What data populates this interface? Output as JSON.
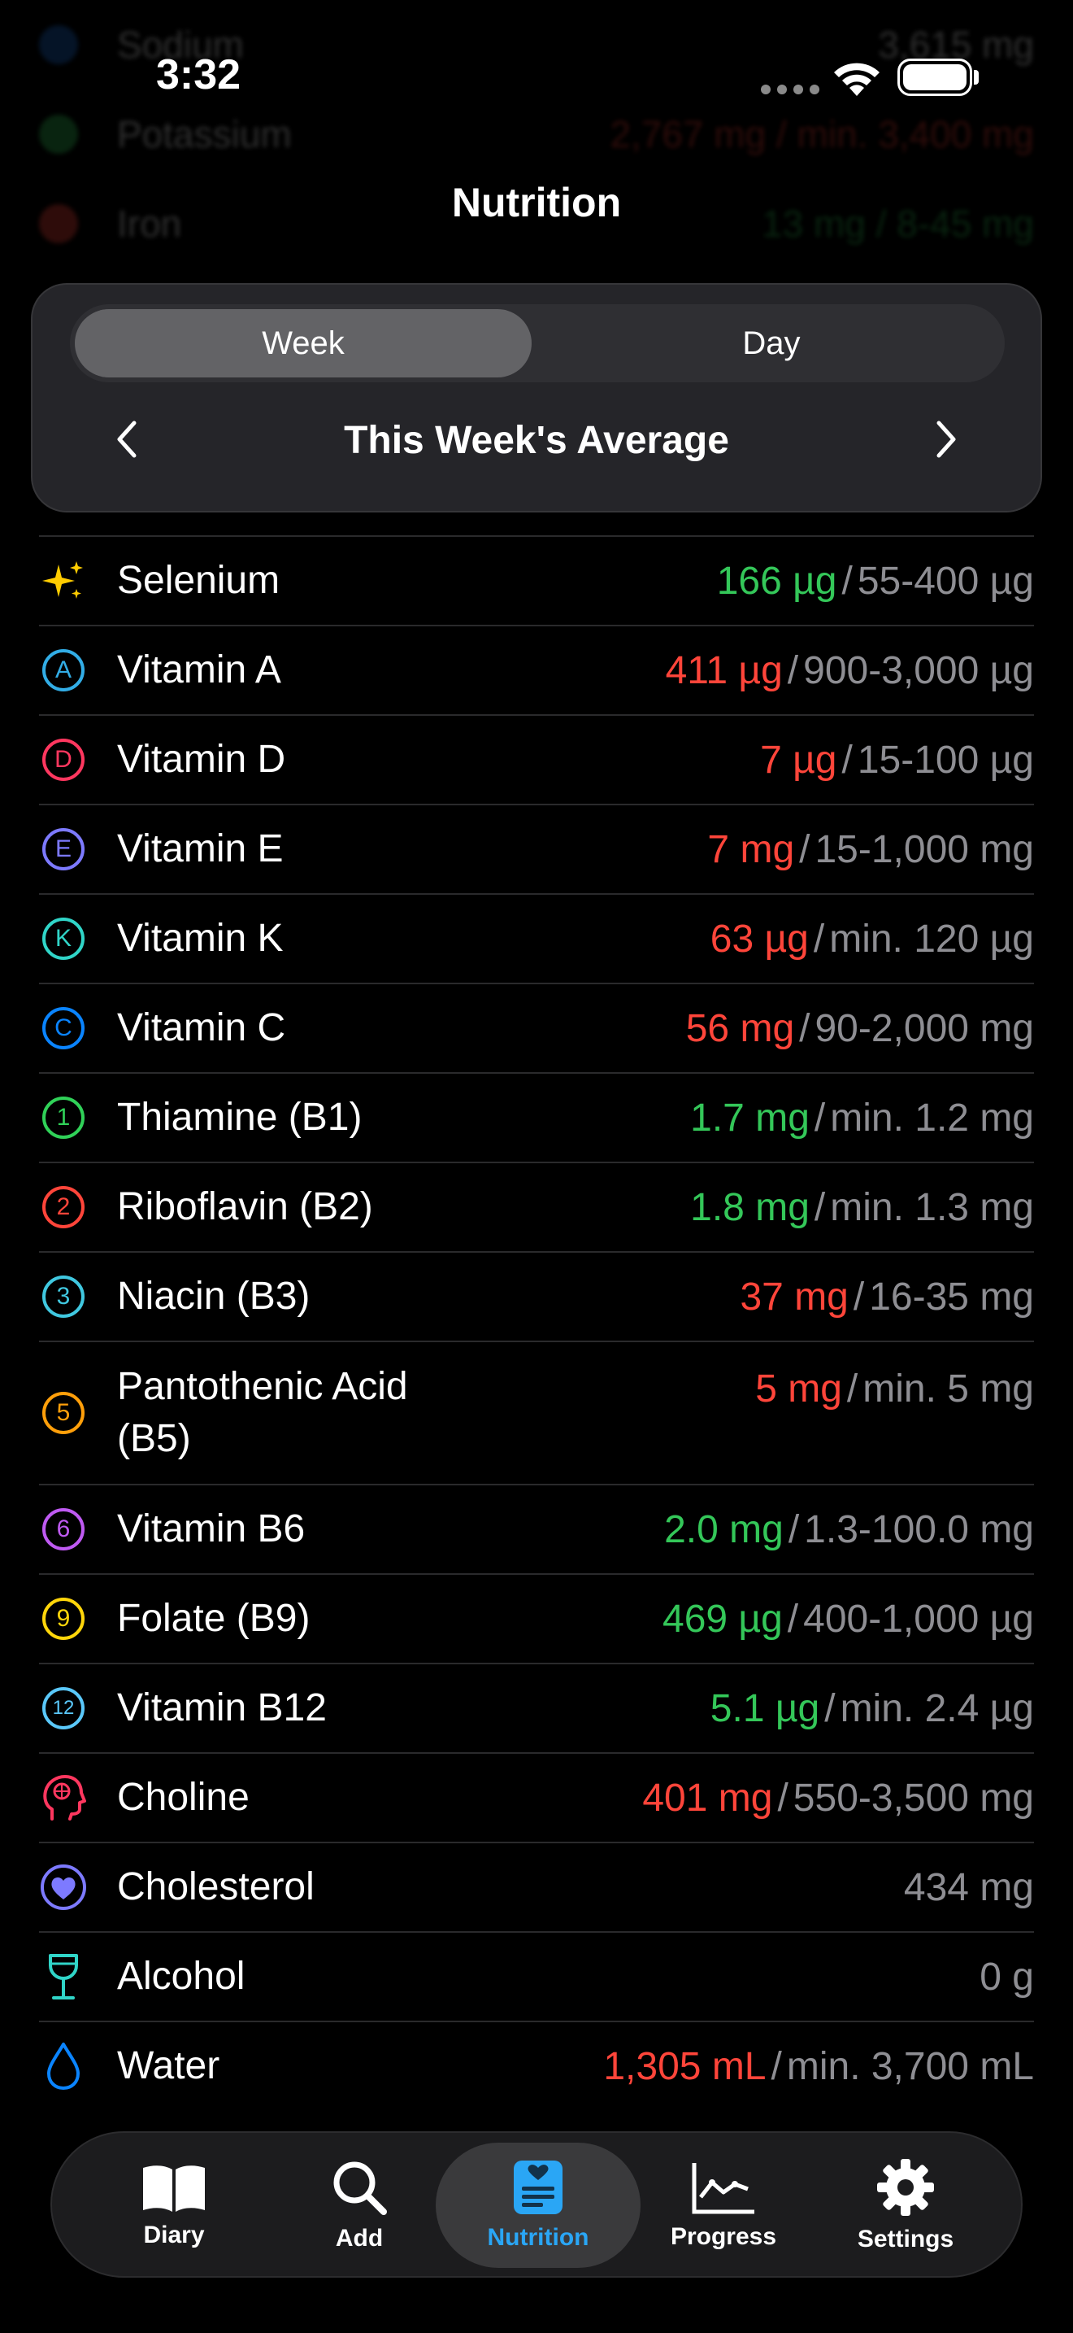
{
  "status": {
    "time": "3:32"
  },
  "header": {
    "title": "Nutrition"
  },
  "background_rows": [
    {
      "name": "Sodium",
      "value": "3,615 mg"
    },
    {
      "name": "Potassium",
      "value": "2,767 mg / min. 3,400 mg"
    },
    {
      "name": "Iron",
      "value": "13 mg / 8-45 mg"
    }
  ],
  "filter": {
    "segments": [
      "Week",
      "Day"
    ],
    "selected": "Week",
    "period_title": "This Week's Average"
  },
  "colors": {
    "green": "#34c759",
    "red": "#ff453a",
    "gray": "#8e8e93",
    "accent": "#2aa6f5"
  },
  "nutrients": [
    {
      "icon": "sparkles-icon",
      "name": "Selenium",
      "amount": "166 µg",
      "status": "green",
      "range": "55-400 µg"
    },
    {
      "icon": "vitamin-a-icon",
      "glyph": "A",
      "name": "Vitamin A",
      "amount": "411 µg",
      "status": "red",
      "range": "900-3,000 µg"
    },
    {
      "icon": "vitamin-d-icon",
      "glyph": "D",
      "name": "Vitamin D",
      "amount": "7 µg",
      "status": "red",
      "range": "15-100 µg"
    },
    {
      "icon": "vitamin-e-icon",
      "glyph": "E",
      "name": "Vitamin E",
      "amount": "7 mg",
      "status": "red",
      "range": "15-1,000 mg"
    },
    {
      "icon": "vitamin-k-icon",
      "glyph": "K",
      "name": "Vitamin K",
      "amount": "63 µg",
      "status": "red",
      "range": "min. 120 µg"
    },
    {
      "icon": "vitamin-c-icon",
      "glyph": "C",
      "name": "Vitamin C",
      "amount": "56 mg",
      "status": "red",
      "range": "90-2,000 mg"
    },
    {
      "icon": "b1-icon",
      "glyph": "1",
      "name": "Thiamine (B1)",
      "amount": "1.7 mg",
      "status": "green",
      "range": "min. 1.2 mg"
    },
    {
      "icon": "b2-icon",
      "glyph": "2",
      "name": "Riboflavin (B2)",
      "amount": "1.8 mg",
      "status": "green",
      "range": "min. 1.3 mg"
    },
    {
      "icon": "b3-icon",
      "glyph": "3",
      "name": "Niacin (B3)",
      "amount": "37 mg",
      "status": "red",
      "range": "16-35 mg"
    },
    {
      "icon": "b5-icon",
      "glyph": "5",
      "name": "Pantothenic Acid (B5)",
      "amount": "5 mg",
      "status": "red",
      "range": "min. 5 mg"
    },
    {
      "icon": "b6-icon",
      "glyph": "6",
      "name": "Vitamin B6",
      "amount": "2.0 mg",
      "status": "green",
      "range": "1.3-100.0 mg"
    },
    {
      "icon": "b9-icon",
      "glyph": "9",
      "name": "Folate (B9)",
      "amount": "469 µg",
      "status": "green",
      "range": "400-1,000 µg"
    },
    {
      "icon": "b12-icon",
      "glyph": "12",
      "name": "Vitamin B12",
      "amount": "5.1 µg",
      "status": "green",
      "range": "min. 2.4 µg"
    },
    {
      "icon": "brain-head-icon",
      "name": "Choline",
      "amount": "401 mg",
      "status": "red",
      "range": "550-3,500 mg"
    },
    {
      "icon": "heart-icon",
      "name": "Cholesterol",
      "amount": "434 mg",
      "status": "gray",
      "range": ""
    },
    {
      "icon": "wine-glass-icon",
      "name": "Alcohol",
      "amount": "0 g",
      "status": "gray",
      "range": ""
    },
    {
      "icon": "water-drop-icon",
      "name": "Water",
      "amount": "1,305 mL",
      "status": "red",
      "range": "min. 3,700 mL"
    }
  ],
  "tabs": [
    {
      "label": "Diary",
      "icon": "book-icon"
    },
    {
      "label": "Add",
      "icon": "search-icon"
    },
    {
      "label": "Nutrition",
      "icon": "nutrition-icon",
      "active": true
    },
    {
      "label": "Progress",
      "icon": "chart-icon"
    },
    {
      "label": "Settings",
      "icon": "gear-icon"
    }
  ]
}
